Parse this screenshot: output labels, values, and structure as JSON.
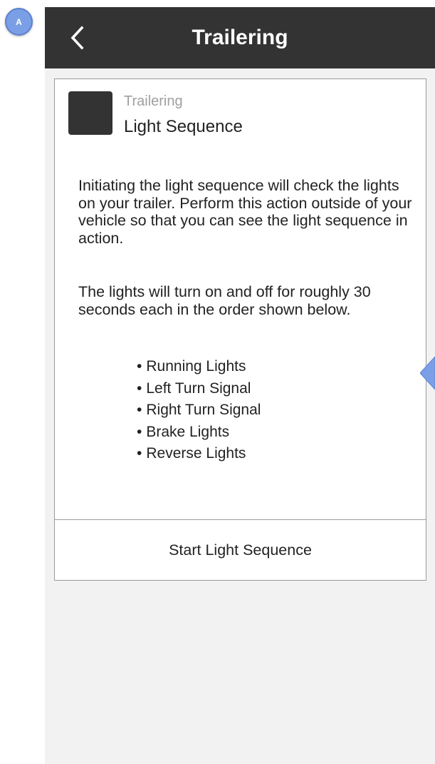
{
  "annotation": {
    "badge_label": "A"
  },
  "header": {
    "title": "Trailering",
    "back_icon": "chevron-left-icon"
  },
  "card": {
    "subtitle": "Trailering",
    "title": "Light Sequence",
    "paragraphs": [
      "Initiating the light sequence will check the lights on your trailer. Perform this action outside of your vehicle so that you can see the light sequence in action.",
      "The lights will turn on and off for roughly 30 seconds each in the order shown below."
    ],
    "sequence": [
      "Running Lights",
      "Left Turn Signal",
      "Right Turn Signal",
      "Brake Lights",
      "Reverse Lights"
    ],
    "action_label": "Start Light Sequence"
  },
  "colors": {
    "header_bg": "#333333",
    "page_bg": "#f2f2f2",
    "badge_bg": "#7b9fe6",
    "pointer": "#7b9fe6"
  }
}
